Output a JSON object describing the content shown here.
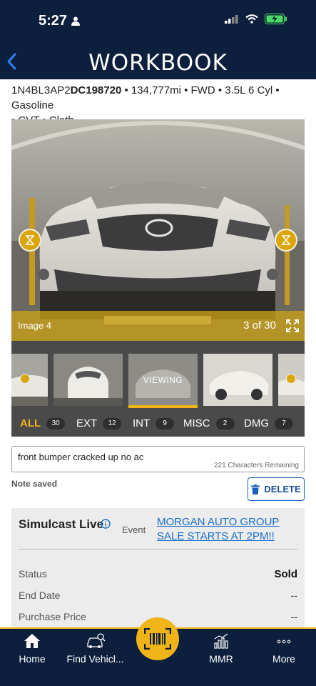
{
  "status_bar": {
    "time": "5:27"
  },
  "header": {
    "title": "WORKBOOK"
  },
  "vehicle": {
    "vin_prefix": "1N4BL3AP2",
    "vin_suffix": "DC198720",
    "specs_line1": " • 134,777mi • FWD • 3.5L 6 Cyl • Gasoline",
    "specs_line2": "• CVT • Cloth"
  },
  "photo": {
    "caption": "Image 4",
    "count": "3 of 30"
  },
  "thumbnails": {
    "viewing_label": "VIEWING"
  },
  "filters": [
    {
      "label": "ALL",
      "count": "30",
      "active": true
    },
    {
      "label": "EXT",
      "count": "12"
    },
    {
      "label": "INT",
      "count": "9"
    },
    {
      "label": "MISC",
      "count": "2"
    },
    {
      "label": "DMG",
      "count": "7"
    }
  ],
  "note": {
    "text": "front bumper cracked up no ac",
    "remaining": "221 Characters Remaining",
    "saved": "Note saved",
    "delete_label": "DELETE"
  },
  "simulcast": {
    "title": "Simulcast Live",
    "event_label": "Event",
    "event_link": "MORGAN AUTO GROUP SALE STARTS AT 2PM!!",
    "rows": [
      {
        "label": "Status",
        "value": "Sold"
      },
      {
        "label": "End Date",
        "value": "--"
      },
      {
        "label": "Purchase Price",
        "value": "--"
      }
    ]
  },
  "bottom_nav": [
    {
      "label": "Home",
      "icon": "home-icon"
    },
    {
      "label": "Find Vehicl...",
      "icon": "car-search-icon"
    },
    {
      "label": "",
      "icon": "barcode-scan-icon"
    },
    {
      "label": "MMR",
      "icon": "chart-icon"
    },
    {
      "label": "More",
      "icon": "more-icon"
    }
  ],
  "colors": {
    "navy": "#0c1f3d",
    "gold": "#f0b419",
    "link": "#1a6fc9"
  }
}
